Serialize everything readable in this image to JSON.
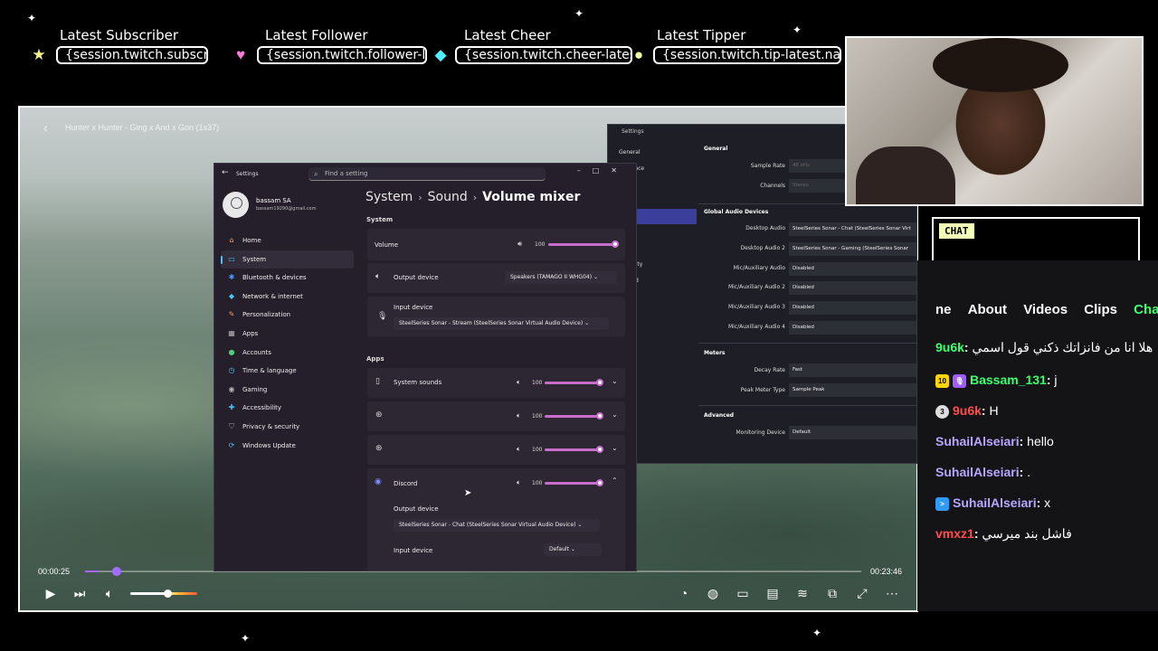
{
  "overlay": {
    "labels": [
      {
        "title": "Latest Subscriber",
        "value": "{session.twitch.subscriber-latest.name}",
        "icon": "star-icon"
      },
      {
        "title": "Latest Follower",
        "value": "{session.twitch.follower-latest.name}",
        "icon": "heart-icon"
      },
      {
        "title": "Latest Cheer",
        "value": "{session.twitch.cheer-latest.name}",
        "icon": "gem-icon"
      },
      {
        "title": "Latest Tipper",
        "value": "{session.twitch.tip-latest.name}",
        "icon": "coin-icon"
      }
    ]
  },
  "video": {
    "title": "Hunter x Hunter - Ging x And x Gon (1x37)",
    "time_current": "00:00:25",
    "time_total": "00:23:46",
    "progress": 0.018,
    "volume": 0.55
  },
  "windows_settings": {
    "window_title": "Settings",
    "search_placeholder": "Find a setting",
    "user_name": "bassam SA",
    "user_email": "bassam19290@gmail.com",
    "nav": [
      {
        "label": "Home",
        "icon": "home-icon"
      },
      {
        "label": "System",
        "icon": "monitor-icon"
      },
      {
        "label": "Bluetooth & devices",
        "icon": "bluetooth-icon"
      },
      {
        "label": "Network & internet",
        "icon": "wifi-icon"
      },
      {
        "label": "Personalization",
        "icon": "brush-icon"
      },
      {
        "label": "Apps",
        "icon": "apps-icon"
      },
      {
        "label": "Accounts",
        "icon": "account-icon"
      },
      {
        "label": "Time & language",
        "icon": "clock-icon"
      },
      {
        "label": "Gaming",
        "icon": "gamepad-icon"
      },
      {
        "label": "Accessibility",
        "icon": "accessibility-icon"
      },
      {
        "label": "Privacy & security",
        "icon": "shield-icon"
      },
      {
        "label": "Windows Update",
        "icon": "update-icon"
      }
    ],
    "breadcrumb": {
      "part1": "System",
      "part2": "Sound",
      "current": "Volume mixer"
    },
    "system_heading": "System",
    "volume_label": "Volume",
    "volume_value": "100",
    "output_device_label": "Output device",
    "output_device_value": "Speakers (TAMAGO II WHG04)",
    "input_device_label": "Input device",
    "input_device_value": "SteelSeries Sonar - Stream (SteelSeries Sonar Virtual Audio Device)",
    "apps_heading": "Apps",
    "apps": [
      {
        "name": "System sounds",
        "volume": "100"
      },
      {
        "name": "",
        "volume": "100"
      },
      {
        "name": "",
        "volume": "100"
      },
      {
        "name": "Discord",
        "volume": "100"
      }
    ],
    "discord_output_label": "Output device",
    "discord_output_value": "SteelSeries Sonar - Chat (SteelSeries Sonar Virtual Audio Device)",
    "discord_input_label": "Input device",
    "discord_input_value": "Default"
  },
  "obs_settings": {
    "window_title": "Settings",
    "sidebar": [
      "General",
      "Appearance",
      "Stream",
      "Output",
      "Audio",
      "Video",
      "Hotkeys",
      "Accessibility",
      "Advanced"
    ],
    "sidebar_visible": [
      "General",
      "pearance",
      "eam",
      "tput",
      "dio",
      "eo",
      "tkeys",
      "essibility",
      "vanced"
    ],
    "general_heading": "General",
    "sample_rate_label": "Sample Rate",
    "sample_rate_value": "48 kHz",
    "channels_label": "Channels",
    "channels_value": "Stereo",
    "global_heading": "Global Audio Devices",
    "devices": [
      {
        "label": "Desktop Audio",
        "value": "SteelSeries Sonar - Chat (SteelSeries Sonar Virt"
      },
      {
        "label": "Desktop Audio 2",
        "value": "SteelSeries Sonar - Gaming (SteelSeries Sonar"
      },
      {
        "label": "Mic/Auxiliary Audio",
        "value": "Disabled"
      },
      {
        "label": "Mic/Auxiliary Audio 2",
        "value": "Disabled"
      },
      {
        "label": "Mic/Auxiliary Audio 3",
        "value": "Disabled"
      },
      {
        "label": "Mic/Auxiliary Audio 4",
        "value": "Disabled"
      }
    ],
    "meters_heading": "Meters",
    "decay_label": "Decay Rate",
    "decay_value": "Fast",
    "peak_label": "Peak Meter Type",
    "peak_value": "Sample Peak",
    "advanced_heading": "Advanced",
    "monitoring_label": "Monitoring Device",
    "monitoring_value": "Default"
  },
  "chat": {
    "tag": "CHAT",
    "tabs": [
      "ne",
      "About",
      "Videos",
      "Clips",
      "Chat"
    ],
    "messages": [
      {
        "user": "9u6k",
        "text": "هلا انا من فانزاتك ذكني قول اسمي",
        "color": "#3cff6e",
        "badge": ""
      },
      {
        "user": "Bassam_131",
        "text": "j",
        "color": "#3cff6e",
        "badge": "10"
      },
      {
        "user": "9u6k",
        "text": "H",
        "color": "#ff4d4d",
        "badge": "3"
      },
      {
        "user": "SuhailAlseiari",
        "text": "hello",
        "color": "#b9a6ff",
        "badge": ""
      },
      {
        "user": "SuhailAlseiari",
        "text": ".",
        "color": "#b9a6ff",
        "badge": ""
      },
      {
        "user": "SuhailAlseiari",
        "text": "x",
        "color": "#b9a6ff",
        "badge": ">"
      },
      {
        "user": "vmxz1",
        "text": "فاشل بند ميرسي",
        "color": "#ff4d4d",
        "badge": ""
      }
    ]
  },
  "colors": {
    "accent": "#c86dc9",
    "seek": "#a56bff",
    "chat_active": "#3cff6e",
    "chat_tag_bg": "#f4ffb8"
  }
}
